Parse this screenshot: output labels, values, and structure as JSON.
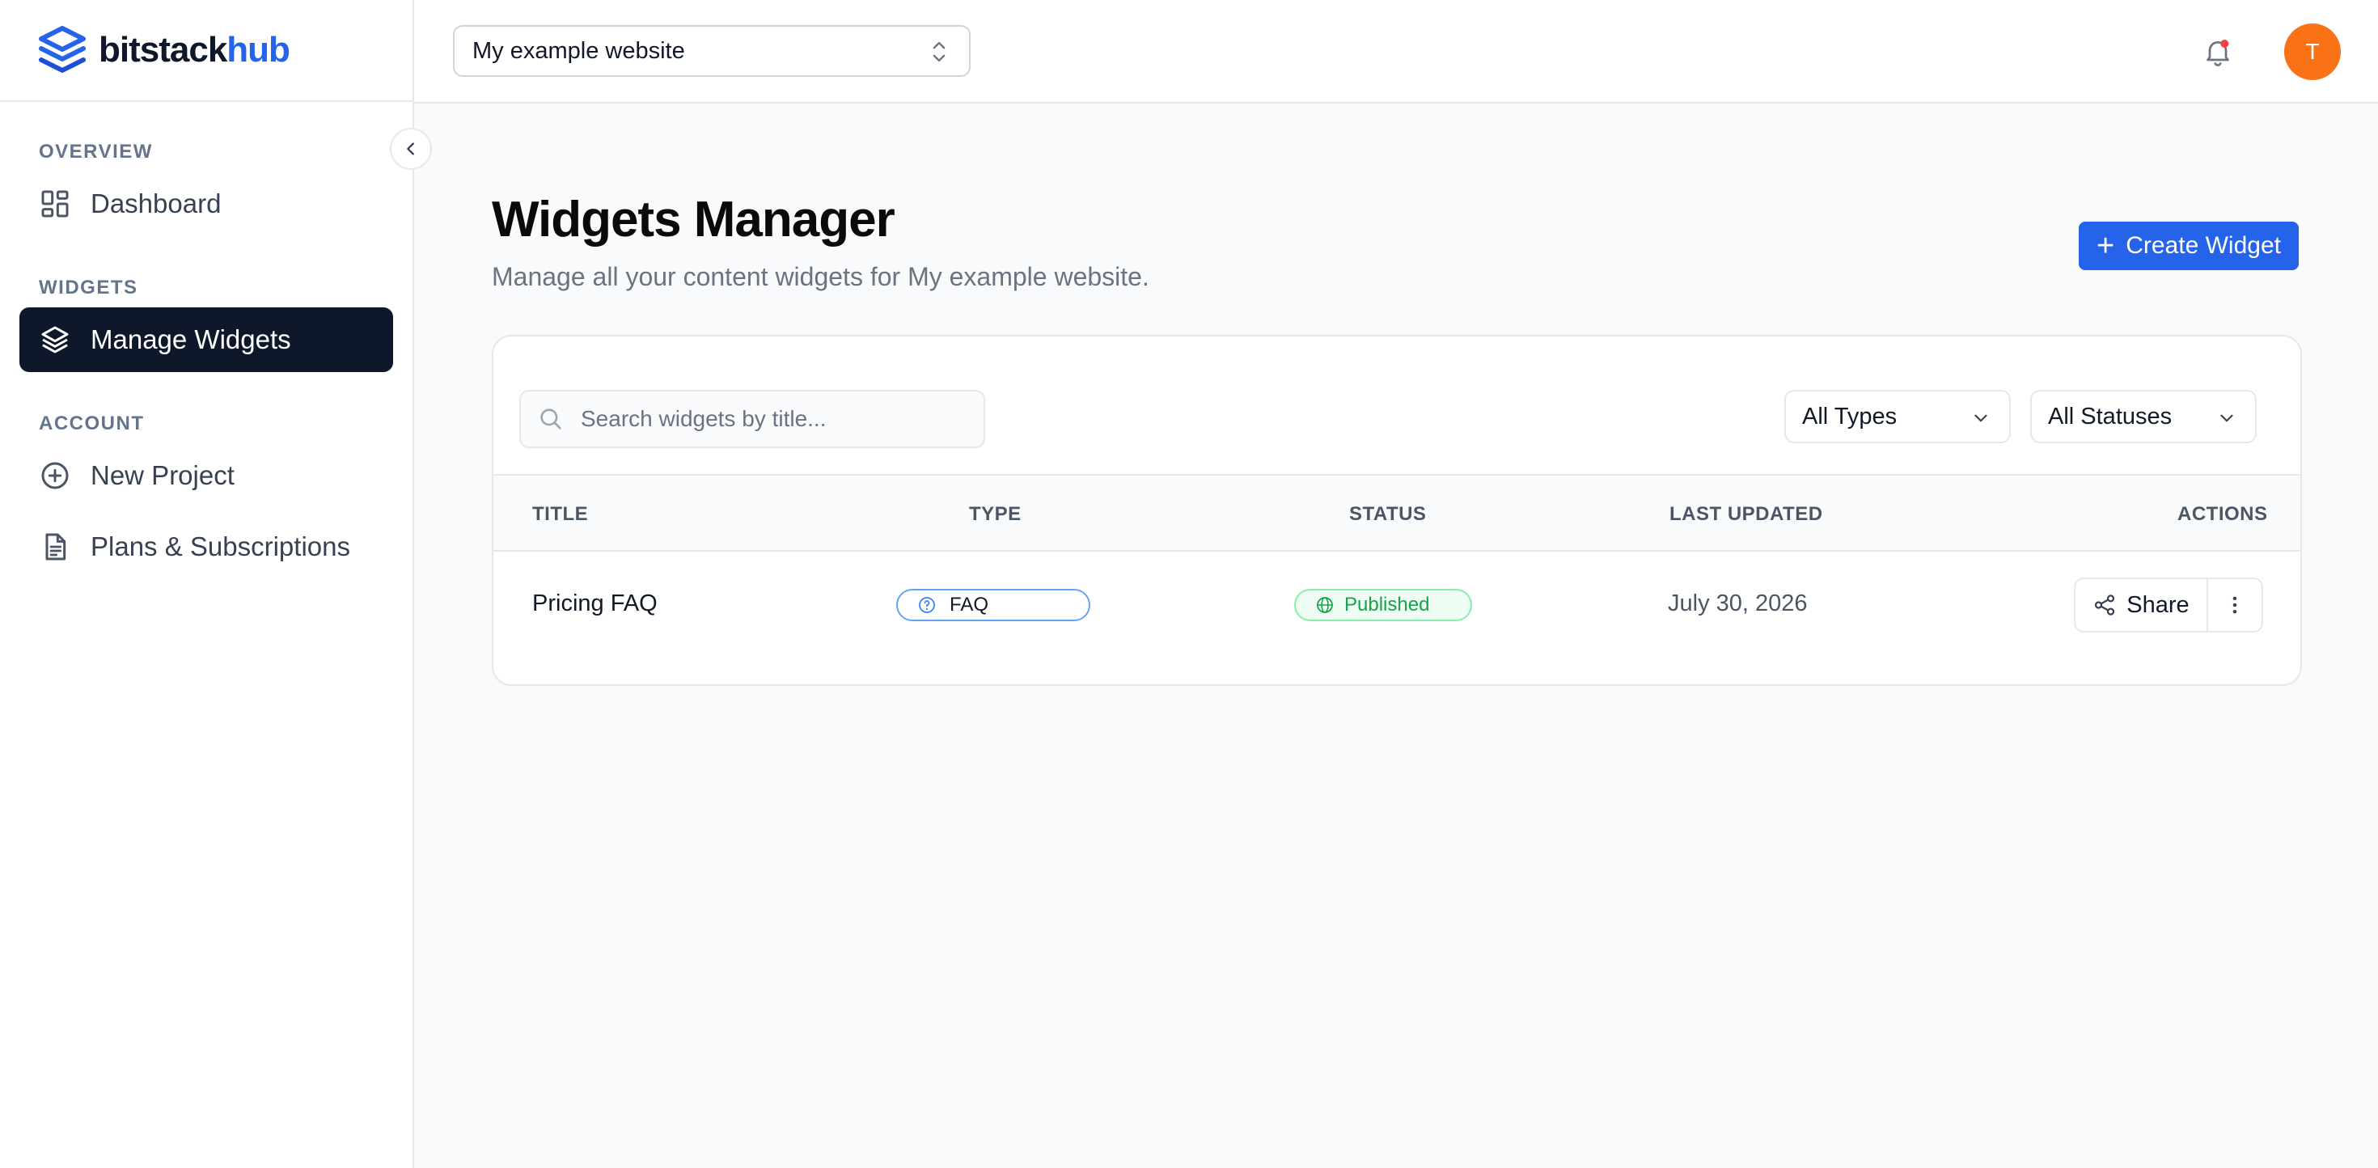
{
  "brand": {
    "name_part1": "bitstack",
    "name_part2": "hub",
    "accent": "#2563eb"
  },
  "sidebar": {
    "sections": [
      {
        "label": "OVERVIEW",
        "items": [
          {
            "label": "Dashboard",
            "icon": "dashboard-icon",
            "active": false
          }
        ]
      },
      {
        "label": "WIDGETS",
        "items": [
          {
            "label": "Manage Widgets",
            "icon": "layers-icon",
            "active": true
          }
        ]
      },
      {
        "label": "ACCOUNT",
        "items": [
          {
            "label": "New Project",
            "icon": "plus-circle-icon",
            "active": false
          },
          {
            "label": "Plans & Subscriptions",
            "icon": "document-icon",
            "active": false
          }
        ]
      }
    ],
    "collapse_icon": "chevron-left-icon"
  },
  "topbar": {
    "site_selector": {
      "value": "My example website",
      "icon": "chevron-up-down-icon"
    },
    "notification_icon": "bell-icon",
    "avatar": {
      "initial": "T",
      "color": "#f97316"
    }
  },
  "main": {
    "title": "Widgets Manager",
    "subtitle": "Manage all your content widgets for My example website.",
    "create_button": {
      "plus": "+",
      "label": "Create Widget"
    },
    "search": {
      "placeholder": "Search widgets by title...",
      "value": ""
    },
    "filters": {
      "type": "All Types",
      "status": "All Statuses"
    },
    "table": {
      "headers": {
        "title": "TITLE",
        "type": "TYPE",
        "status": "STATUS",
        "updated": "LAST UPDATED",
        "actions": "ACTIONS"
      },
      "rows": [
        {
          "title": "Pricing FAQ",
          "type": "FAQ",
          "status": "Published",
          "updated": "July 30, 2026",
          "share_label": "Share"
        }
      ]
    }
  }
}
